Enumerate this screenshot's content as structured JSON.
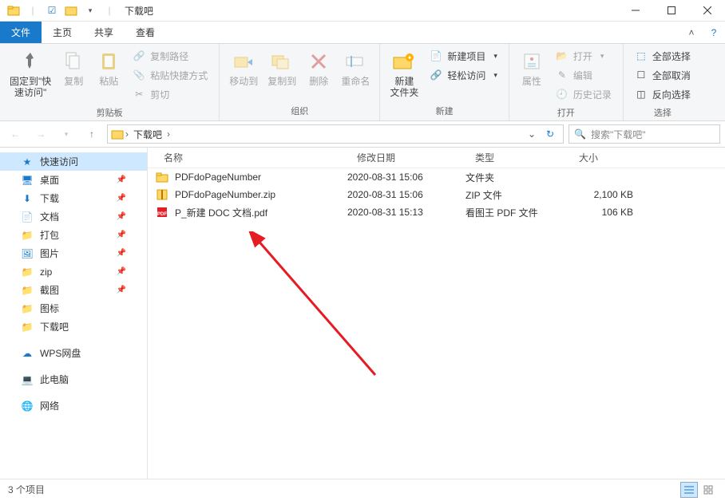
{
  "window": {
    "title": "下载吧"
  },
  "tabs": {
    "file": "文件",
    "home": "主页",
    "share": "共享",
    "view": "查看"
  },
  "ribbon": {
    "clipboard": {
      "pin": "固定到\"快\n速访问\"",
      "copy": "复制",
      "paste": "粘贴",
      "copypath": "复制路径",
      "pasteshortcut": "粘贴快捷方式",
      "cut": "剪切",
      "label": "剪贴板"
    },
    "organize": {
      "moveto": "移动到",
      "copyto": "复制到",
      "delete": "删除",
      "rename": "重命名",
      "label": "组织"
    },
    "new": {
      "newfolder": "新建\n文件夹",
      "newitem": "新建项目",
      "easyaccess": "轻松访问",
      "label": "新建"
    },
    "open": {
      "properties": "属性",
      "open": "打开",
      "edit": "编辑",
      "history": "历史记录",
      "label": "打开"
    },
    "select": {
      "selectall": "全部选择",
      "selectnone": "全部取消",
      "invert": "反向选择",
      "label": "选择"
    }
  },
  "breadcrumb": {
    "seg1": "下载吧"
  },
  "search": {
    "placeholder": "搜索\"下载吧\""
  },
  "nav": {
    "quick": "快速访问",
    "desktop": "桌面",
    "downloads": "下载",
    "documents": "文档",
    "pack": "打包",
    "pictures": "图片",
    "zip": "zip",
    "screenshot": "截图",
    "icons": "图标",
    "xzb": "下载吧",
    "wps": "WPS网盘",
    "thispc": "此电脑",
    "network": "网络"
  },
  "columns": {
    "name": "名称",
    "date": "修改日期",
    "type": "类型",
    "size": "大小"
  },
  "files": [
    {
      "icon": "folder",
      "name": "PDFdoPageNumber",
      "date": "2020-08-31 15:06",
      "type": "文件夹",
      "size": ""
    },
    {
      "icon": "zip",
      "name": "PDFdoPageNumber.zip",
      "date": "2020-08-31 15:06",
      "type": "ZIP 文件",
      "size": "2,100 KB"
    },
    {
      "icon": "pdf",
      "name": "P_新建 DOC 文档.pdf",
      "date": "2020-08-31 15:13",
      "type": "看图王 PDF 文件",
      "size": "106 KB"
    }
  ],
  "status": {
    "count": "3 个项目"
  }
}
